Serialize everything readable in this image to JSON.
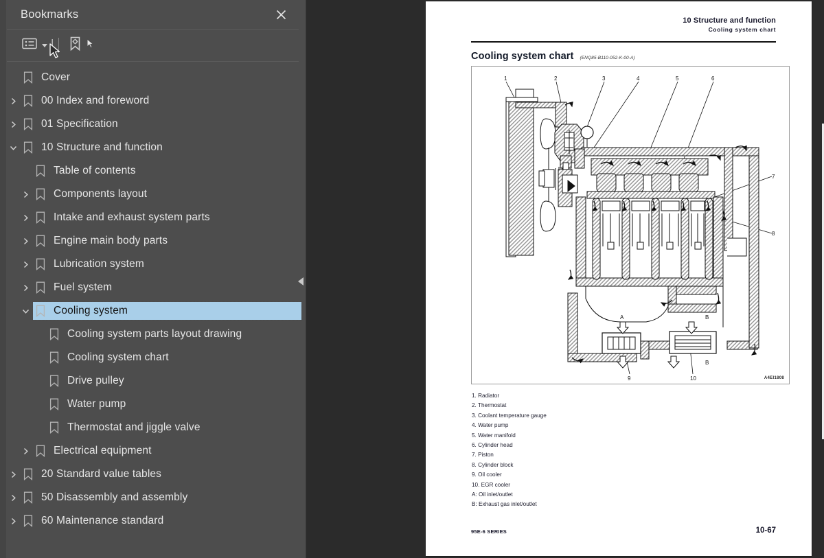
{
  "panel": {
    "title": "Bookmarks",
    "close_icon": "close-icon",
    "toolbar": {
      "options_icon": "list-options-icon",
      "dropdown_caret_icon": "chevron-down-icon",
      "new_bookmark_icon": "bookmark-settings-icon",
      "text_cursor_icon": "text-cursor-icon",
      "mouse_pointer_icon": "mouse-pointer-icon"
    },
    "collapse_handle_icon": "chevron-left-icon",
    "items": [
      {
        "label": "Cover",
        "level": 0,
        "twisty": "none"
      },
      {
        "label": "00 Index and foreword",
        "level": 0,
        "twisty": "collapsed"
      },
      {
        "label": "01 Specification",
        "level": 0,
        "twisty": "collapsed"
      },
      {
        "label": "10 Structure and function",
        "level": 0,
        "twisty": "expanded"
      },
      {
        "label": "Table of contents",
        "level": 1,
        "twisty": "none"
      },
      {
        "label": "Components layout",
        "level": 1,
        "twisty": "collapsed"
      },
      {
        "label": "Intake and exhaust system parts",
        "level": 1,
        "twisty": "collapsed"
      },
      {
        "label": "Engine main body parts",
        "level": 1,
        "twisty": "collapsed"
      },
      {
        "label": "Lubrication system",
        "level": 1,
        "twisty": "collapsed"
      },
      {
        "label": "Fuel system",
        "level": 1,
        "twisty": "collapsed"
      },
      {
        "label": "Cooling system",
        "level": 1,
        "twisty": "expanded",
        "selected": true
      },
      {
        "label": "Cooling system parts layout drawing",
        "level": 2,
        "twisty": "none"
      },
      {
        "label": "Cooling system chart",
        "level": 2,
        "twisty": "none"
      },
      {
        "label": "Drive pulley",
        "level": 2,
        "twisty": "none"
      },
      {
        "label": "Water pump",
        "level": 2,
        "twisty": "none"
      },
      {
        "label": "Thermostat and jiggle valve",
        "level": 2,
        "twisty": "none"
      },
      {
        "label": "Electrical equipment",
        "level": 1,
        "twisty": "collapsed"
      },
      {
        "label": "20 Standard value tables",
        "level": 0,
        "twisty": "collapsed"
      },
      {
        "label": "50 Disassembly and assembly",
        "level": 0,
        "twisty": "collapsed"
      },
      {
        "label": "60 Maintenance standard",
        "level": 0,
        "twisty": "collapsed"
      }
    ]
  },
  "page": {
    "header_chapter": "10 Structure and function",
    "header_section": "Cooling system chart",
    "title": "Cooling system chart",
    "title_code": "(ENQ85-B110-052-K-00-A)",
    "figure_id": "A4EI1808",
    "legend": [
      "1. Radiator",
      "2. Thermostat",
      "3. Coolant temperature gauge",
      "4. Water pump",
      "5. Water manifold",
      "6. Cylinder head",
      "7. Piston",
      "8. Cylinder block",
      "9. Oil cooler",
      "10. EGR cooler",
      "A: Oil inlet/outlet",
      "B: Exhaust gas inlet/outlet"
    ],
    "footer_left": "95E-6 SERIES",
    "footer_right": "10-67",
    "callouts": [
      "1",
      "2",
      "3",
      "4",
      "5",
      "6",
      "7",
      "8",
      "9",
      "10",
      "A",
      "B"
    ]
  },
  "colors": {
    "panel_bg": "#4d4d4d",
    "viewer_bg": "#2b2b2b",
    "selection": "#a9cfe9",
    "text": "#e6e6e6"
  }
}
